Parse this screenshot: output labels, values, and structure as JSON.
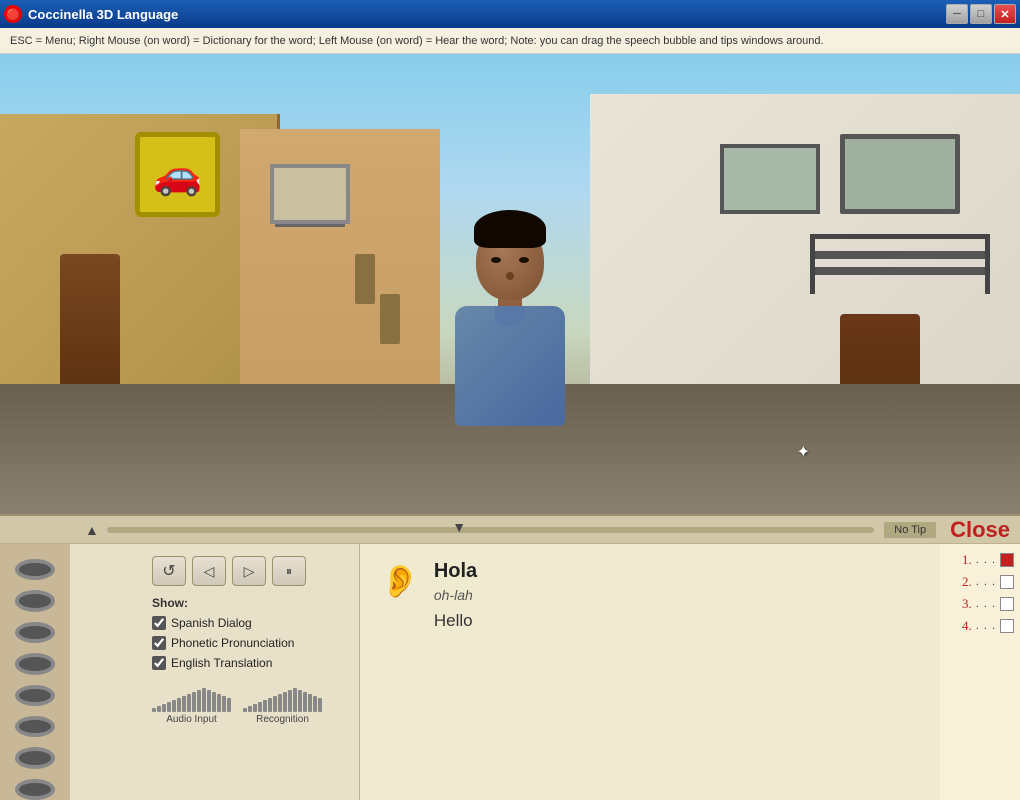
{
  "titleBar": {
    "title": "Coccinella 3D Language",
    "icon": "C",
    "minBtn": "─",
    "maxBtn": "□",
    "closeBtn": "✕"
  },
  "hintBar": {
    "text": "ESC = Menu;   Right Mouse (on word) = Dictionary for the word;   Left Mouse (on word) = Hear the word;   Note: you can drag the speech bubble and tips windows around."
  },
  "progressBar": {
    "noTipLabel": "No Tip",
    "closeLabel": "Close"
  },
  "controls": {
    "rewindIcon": "↺",
    "backIcon": "◁",
    "playIcon": "▷",
    "pauseIcon": "⏸"
  },
  "show": {
    "label": "Show:",
    "spanishDialog": "Spanish Dialog",
    "phoneticPronunciation": "Phonetic Pronunciation",
    "englishTranslation": "English Translation",
    "spanishChecked": true,
    "phoneticChecked": true,
    "englishChecked": true
  },
  "audio": {
    "audioInputLabel": "Audio Input",
    "recognitionLabel": "Recognition"
  },
  "dialog": {
    "spanish": "Hola",
    "phonetic": "oh-lah",
    "english": "Hello"
  },
  "numbers": [
    {
      "num": "1.",
      "dots": "...",
      "checked": true
    },
    {
      "num": "2.",
      "dots": "...",
      "checked": false
    },
    {
      "num": "3.",
      "dots": "...",
      "checked": false
    },
    {
      "num": "4.",
      "dots": "...",
      "checked": false
    }
  ],
  "meterBars": [
    2,
    4,
    6,
    8,
    10,
    12,
    14,
    16,
    18,
    20,
    22,
    24,
    26
  ],
  "recoBars": [
    2,
    4,
    6,
    8,
    10,
    12,
    14,
    16,
    18,
    20,
    22,
    24,
    26
  ]
}
